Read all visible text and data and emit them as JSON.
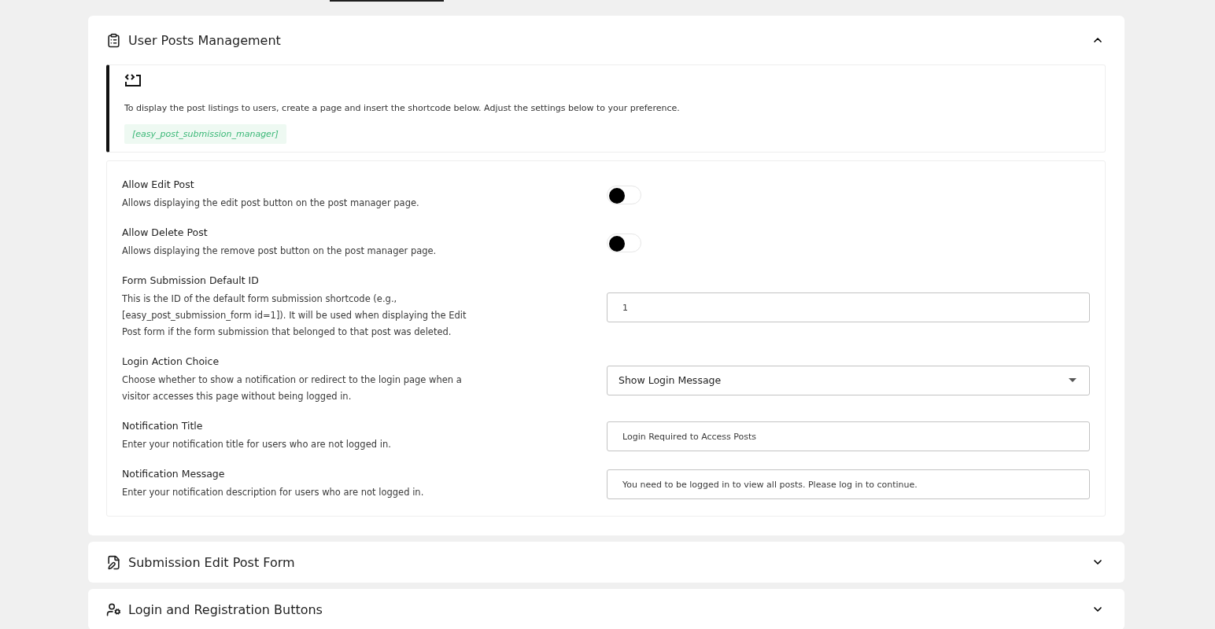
{
  "sections": [
    {
      "kind": "posts",
      "title": "User Posts Management",
      "expanded": true,
      "notice": {
        "text": "To display the post listings to users, create a page and insert the shortcode below. Adjust the settings below to your preference.",
        "shortcode": "[easy_post_submission_manager]"
      },
      "settings": [
        {
          "kind": "toggle",
          "label": "Allow Edit Post",
          "description": "Allows displaying the edit post button on the post manager page.",
          "on": false
        },
        {
          "kind": "toggle",
          "label": "Allow Delete Post",
          "description": "Allows displaying the remove post button on the post manager page.",
          "on": false
        },
        {
          "kind": "input",
          "label": "Form Submission Default ID",
          "description": "This is the ID of the default form submission shortcode (e.g., [easy_post_submission_form id=1]). It will be used when displaying the Edit Post form if the form submission that belonged to that post was deleted.",
          "value": "1"
        },
        {
          "kind": "select",
          "label": "Login Action Choice",
          "description": "Choose whether to show a notification or redirect to the login page when a visitor accesses this page without being logged in.",
          "value": "Show Login Message"
        },
        {
          "kind": "input",
          "label": "Notification Title",
          "description": "Enter your notification title for users who are not logged in.",
          "value": "Login Required to Access Posts"
        },
        {
          "kind": "input",
          "label": "Notification Message",
          "description": "Enter your notification description for users who are not logged in.",
          "value": "You need to be logged in to view all posts. Please log in to continue."
        }
      ]
    },
    {
      "kind": "form",
      "title": "Submission Edit Post Form",
      "expanded": false
    },
    {
      "kind": "user",
      "title": "Login and Registration Buttons",
      "expanded": false
    }
  ]
}
